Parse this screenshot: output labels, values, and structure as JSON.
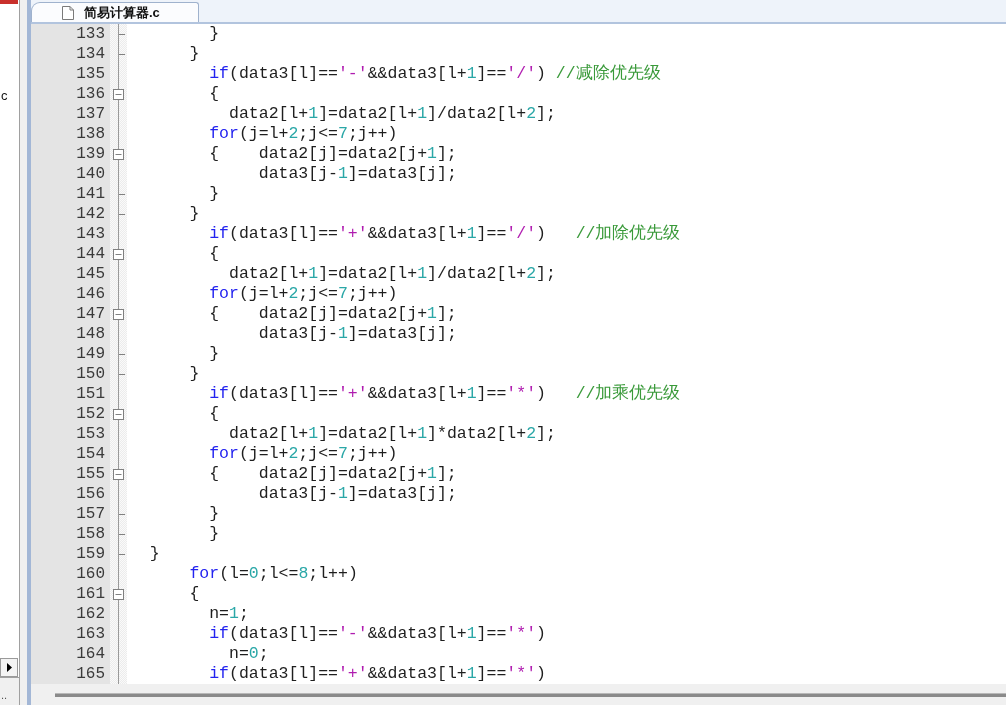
{
  "side_panel": {
    "text": "c",
    "status_text": ".."
  },
  "editor": {
    "tab": {
      "label": "简易计算器.c",
      "selected": true
    },
    "lines": [
      {
        "number": "133",
        "kind": "end",
        "tokens": [
          {
            "kind": "plain",
            "text": "        }"
          }
        ]
      },
      {
        "number": "134",
        "kind": "end",
        "tokens": [
          {
            "kind": "plain",
            "text": "      }"
          }
        ]
      },
      {
        "number": "135",
        "kind": "body",
        "tokens": [
          {
            "kind": "keyword",
            "text": "        if"
          },
          {
            "kind": "plain",
            "text": "(data3[l]=="
          },
          {
            "kind": "char",
            "text": "'-'"
          },
          {
            "kind": "plain",
            "text": "&&data3[l+"
          },
          {
            "kind": "number",
            "text": "1"
          },
          {
            "kind": "plain",
            "text": "]=="
          },
          {
            "kind": "char",
            "text": "'/'"
          },
          {
            "kind": "plain",
            "text": ") "
          },
          {
            "kind": "comment",
            "text": "//减除优先级"
          }
        ]
      },
      {
        "number": "136",
        "kind": "header",
        "expanded": true,
        "tokens": [
          {
            "kind": "plain",
            "text": "        {"
          }
        ]
      },
      {
        "number": "137",
        "kind": "body",
        "tokens": [
          {
            "kind": "plain",
            "text": "          data2[l+"
          },
          {
            "kind": "number",
            "text": "1"
          },
          {
            "kind": "plain",
            "text": "]=data2[l+"
          },
          {
            "kind": "number",
            "text": "1"
          },
          {
            "kind": "plain",
            "text": "]/data2[l+"
          },
          {
            "kind": "number",
            "text": "2"
          },
          {
            "kind": "plain",
            "text": "];"
          }
        ]
      },
      {
        "number": "138",
        "kind": "body",
        "tokens": [
          {
            "kind": "keyword",
            "text": "        for"
          },
          {
            "kind": "plain",
            "text": "(j=l+"
          },
          {
            "kind": "number",
            "text": "2"
          },
          {
            "kind": "plain",
            "text": ";j<="
          },
          {
            "kind": "number",
            "text": "7"
          },
          {
            "kind": "plain",
            "text": ";j++)"
          }
        ]
      },
      {
        "number": "139",
        "kind": "header",
        "expanded": true,
        "tokens": [
          {
            "kind": "plain",
            "text": "        {    data2[j]=data2[j+"
          },
          {
            "kind": "number",
            "text": "1"
          },
          {
            "kind": "plain",
            "text": "];"
          }
        ]
      },
      {
        "number": "140",
        "kind": "body",
        "tokens": [
          {
            "kind": "plain",
            "text": "             data3[j-"
          },
          {
            "kind": "number",
            "text": "1"
          },
          {
            "kind": "plain",
            "text": "]=data3[j];"
          }
        ]
      },
      {
        "number": "141",
        "kind": "end",
        "tokens": [
          {
            "kind": "plain",
            "text": "        }"
          }
        ]
      },
      {
        "number": "142",
        "kind": "end",
        "tokens": [
          {
            "kind": "plain",
            "text": "      }"
          }
        ]
      },
      {
        "number": "143",
        "kind": "body",
        "tokens": [
          {
            "kind": "keyword",
            "text": "        if"
          },
          {
            "kind": "plain",
            "text": "(data3[l]=="
          },
          {
            "kind": "char",
            "text": "'+'"
          },
          {
            "kind": "plain",
            "text": "&&data3[l+"
          },
          {
            "kind": "number",
            "text": "1"
          },
          {
            "kind": "plain",
            "text": "]=="
          },
          {
            "kind": "char",
            "text": "'/'"
          },
          {
            "kind": "plain",
            "text": ")   "
          },
          {
            "kind": "comment",
            "text": "//加除优先级"
          }
        ]
      },
      {
        "number": "144",
        "kind": "header",
        "expanded": true,
        "tokens": [
          {
            "kind": "plain",
            "text": "        {"
          }
        ]
      },
      {
        "number": "145",
        "kind": "body",
        "tokens": [
          {
            "kind": "plain",
            "text": "          data2[l+"
          },
          {
            "kind": "number",
            "text": "1"
          },
          {
            "kind": "plain",
            "text": "]=data2[l+"
          },
          {
            "kind": "number",
            "text": "1"
          },
          {
            "kind": "plain",
            "text": "]/data2[l+"
          },
          {
            "kind": "number",
            "text": "2"
          },
          {
            "kind": "plain",
            "text": "];"
          }
        ]
      },
      {
        "number": "146",
        "kind": "body",
        "tokens": [
          {
            "kind": "keyword",
            "text": "        for"
          },
          {
            "kind": "plain",
            "text": "(j=l+"
          },
          {
            "kind": "number",
            "text": "2"
          },
          {
            "kind": "plain",
            "text": ";j<="
          },
          {
            "kind": "number",
            "text": "7"
          },
          {
            "kind": "plain",
            "text": ";j++)"
          }
        ]
      },
      {
        "number": "147",
        "kind": "header",
        "expanded": true,
        "tokens": [
          {
            "kind": "plain",
            "text": "        {    data2[j]=data2[j+"
          },
          {
            "kind": "number",
            "text": "1"
          },
          {
            "kind": "plain",
            "text": "];"
          }
        ]
      },
      {
        "number": "148",
        "kind": "body",
        "tokens": [
          {
            "kind": "plain",
            "text": "             data3[j-"
          },
          {
            "kind": "number",
            "text": "1"
          },
          {
            "kind": "plain",
            "text": "]=data3[j];"
          }
        ]
      },
      {
        "number": "149",
        "kind": "end",
        "tokens": [
          {
            "kind": "plain",
            "text": "        }"
          }
        ]
      },
      {
        "number": "150",
        "kind": "end",
        "tokens": [
          {
            "kind": "plain",
            "text": "      }"
          }
        ]
      },
      {
        "number": "151",
        "kind": "body",
        "tokens": [
          {
            "kind": "keyword",
            "text": "        if"
          },
          {
            "kind": "plain",
            "text": "(data3[l]=="
          },
          {
            "kind": "char",
            "text": "'+'"
          },
          {
            "kind": "plain",
            "text": "&&data3[l+"
          },
          {
            "kind": "number",
            "text": "1"
          },
          {
            "kind": "plain",
            "text": "]=="
          },
          {
            "kind": "char",
            "text": "'*'"
          },
          {
            "kind": "plain",
            "text": ")   "
          },
          {
            "kind": "comment",
            "text": "//加乘优先级"
          }
        ]
      },
      {
        "number": "152",
        "kind": "header",
        "expanded": true,
        "tokens": [
          {
            "kind": "plain",
            "text": "        {"
          }
        ]
      },
      {
        "number": "153",
        "kind": "body",
        "tokens": [
          {
            "kind": "plain",
            "text": "          data2[l+"
          },
          {
            "kind": "number",
            "text": "1"
          },
          {
            "kind": "plain",
            "text": "]=data2[l+"
          },
          {
            "kind": "number",
            "text": "1"
          },
          {
            "kind": "plain",
            "text": "]*data2[l+"
          },
          {
            "kind": "number",
            "text": "2"
          },
          {
            "kind": "plain",
            "text": "];"
          }
        ]
      },
      {
        "number": "154",
        "kind": "body",
        "tokens": [
          {
            "kind": "keyword",
            "text": "        for"
          },
          {
            "kind": "plain",
            "text": "(j=l+"
          },
          {
            "kind": "number",
            "text": "2"
          },
          {
            "kind": "plain",
            "text": ";j<="
          },
          {
            "kind": "number",
            "text": "7"
          },
          {
            "kind": "plain",
            "text": ";j++)"
          }
        ]
      },
      {
        "number": "155",
        "kind": "header",
        "expanded": true,
        "tokens": [
          {
            "kind": "plain",
            "text": "        {    data2[j]=data2[j+"
          },
          {
            "kind": "number",
            "text": "1"
          },
          {
            "kind": "plain",
            "text": "];"
          }
        ]
      },
      {
        "number": "156",
        "kind": "body",
        "tokens": [
          {
            "kind": "plain",
            "text": "             data3[j-"
          },
          {
            "kind": "number",
            "text": "1"
          },
          {
            "kind": "plain",
            "text": "]=data3[j];"
          }
        ]
      },
      {
        "number": "157",
        "kind": "end",
        "tokens": [
          {
            "kind": "plain",
            "text": "        }"
          }
        ]
      },
      {
        "number": "158",
        "kind": "end",
        "tokens": [
          {
            "kind": "plain",
            "text": "        }"
          }
        ]
      },
      {
        "number": "159",
        "kind": "end",
        "tokens": [
          {
            "kind": "plain",
            "text": "  }"
          }
        ]
      },
      {
        "number": "160",
        "kind": "body",
        "tokens": [
          {
            "kind": "keyword",
            "text": "      for"
          },
          {
            "kind": "plain",
            "text": "(l="
          },
          {
            "kind": "number",
            "text": "0"
          },
          {
            "kind": "plain",
            "text": ";l<="
          },
          {
            "kind": "number",
            "text": "8"
          },
          {
            "kind": "plain",
            "text": ";l++)"
          }
        ]
      },
      {
        "number": "161",
        "kind": "header",
        "expanded": true,
        "tokens": [
          {
            "kind": "plain",
            "text": "      {"
          }
        ]
      },
      {
        "number": "162",
        "kind": "body",
        "tokens": [
          {
            "kind": "plain",
            "text": "        n="
          },
          {
            "kind": "number",
            "text": "1"
          },
          {
            "kind": "plain",
            "text": ";"
          }
        ]
      },
      {
        "number": "163",
        "kind": "body",
        "tokens": [
          {
            "kind": "keyword",
            "text": "        if"
          },
          {
            "kind": "plain",
            "text": "(data3[l]=="
          },
          {
            "kind": "char",
            "text": "'-'"
          },
          {
            "kind": "plain",
            "text": "&&data3[l+"
          },
          {
            "kind": "number",
            "text": "1"
          },
          {
            "kind": "plain",
            "text": "]=="
          },
          {
            "kind": "char",
            "text": "'*'"
          },
          {
            "kind": "plain",
            "text": ")"
          }
        ]
      },
      {
        "number": "164",
        "kind": "body",
        "tokens": [
          {
            "kind": "plain",
            "text": "          n="
          },
          {
            "kind": "number",
            "text": "0"
          },
          {
            "kind": "plain",
            "text": ";"
          }
        ]
      },
      {
        "number": "165",
        "kind": "body",
        "tokens": [
          {
            "kind": "keyword",
            "text": "        if"
          },
          {
            "kind": "plain",
            "text": "(data3[l]=="
          },
          {
            "kind": "char",
            "text": "'+'"
          },
          {
            "kind": "plain",
            "text": "&&data3[l+"
          },
          {
            "kind": "number",
            "text": "1"
          },
          {
            "kind": "plain",
            "text": "]=="
          },
          {
            "kind": "char",
            "text": "'*'"
          },
          {
            "kind": "plain",
            "text": ")"
          }
        ]
      }
    ]
  }
}
